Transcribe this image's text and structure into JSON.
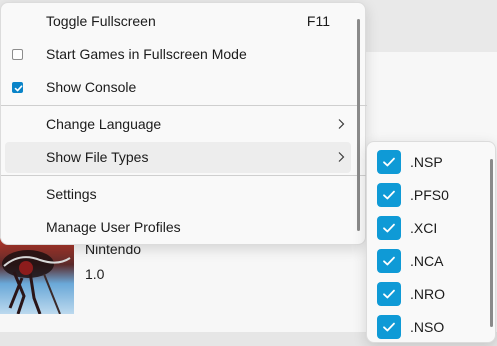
{
  "game": {
    "publisher": "Nintendo",
    "version": "1.0"
  },
  "menu": {
    "items": [
      {
        "label": "Toggle Fullscreen",
        "accelerator": "F11"
      },
      {
        "label": "Start Games in Fullscreen Mode",
        "checked": false
      },
      {
        "label": "Show Console",
        "checked": true
      },
      {
        "label": "Change Language",
        "submenu": true
      },
      {
        "label": "Show File Types",
        "submenu": true,
        "highlighted": true
      },
      {
        "label": "Settings"
      },
      {
        "label": "Manage User Profiles"
      }
    ]
  },
  "file_types": {
    "items": [
      {
        "label": ".NSP",
        "checked": true
      },
      {
        "label": ".PFS0",
        "checked": true
      },
      {
        "label": ".XCI",
        "checked": true
      },
      {
        "label": ".NCA",
        "checked": true
      },
      {
        "label": ".NRO",
        "checked": true
      },
      {
        "label": ".NSO",
        "checked": true
      }
    ]
  },
  "colors": {
    "accent": "#0f9ad6",
    "menu_background": "#f9f9f9",
    "hover_background": "#ededed"
  },
  "icons": {
    "checked": "checkmark-icon",
    "submenu": "chevron-right-icon"
  }
}
